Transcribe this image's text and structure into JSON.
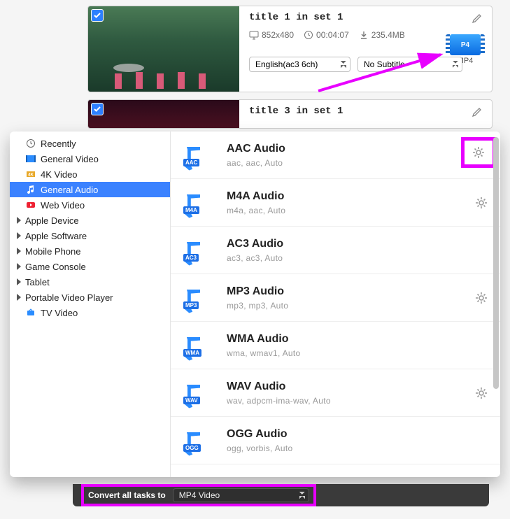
{
  "tasks": [
    {
      "title": "title 1 in set 1",
      "resolution": "852x480",
      "duration": "00:04:07",
      "size": "235.4MB",
      "format_short": "P4",
      "format_label": "MP4",
      "audio_track": "English(ac3 6ch)",
      "subtitle": "No Subtitle"
    },
    {
      "title": "title 3 in set 1"
    }
  ],
  "sidebar": {
    "items": [
      {
        "label": "Recently",
        "icon": "clock"
      },
      {
        "label": "General Video",
        "icon": "film"
      },
      {
        "label": "4K Video",
        "icon": "4k"
      },
      {
        "label": "General Audio",
        "icon": "note",
        "selected": true
      },
      {
        "label": "Web Video",
        "icon": "youtube"
      },
      {
        "label": "Apple Device",
        "expandable": true
      },
      {
        "label": "Apple Software",
        "expandable": true
      },
      {
        "label": "Mobile Phone",
        "expandable": true
      },
      {
        "label": "Game Console",
        "expandable": true
      },
      {
        "label": "Tablet",
        "expandable": true
      },
      {
        "label": "Portable Video Player",
        "expandable": true
      },
      {
        "label": "TV Video",
        "icon": "tv"
      }
    ]
  },
  "formats": [
    {
      "tag": "AAC",
      "title": "AAC Audio",
      "sub": "aac,    aac,    Auto"
    },
    {
      "tag": "M4A",
      "title": "M4A Audio",
      "sub": "m4a,    aac,    Auto"
    },
    {
      "tag": "AC3",
      "title": "AC3 Audio",
      "sub": "ac3,    ac3,    Auto"
    },
    {
      "tag": "MP3",
      "title": "MP3 Audio",
      "sub": "mp3,    mp3,    Auto"
    },
    {
      "tag": "WMA",
      "title": "WMA Audio",
      "sub": "wma,    wmav1,    Auto"
    },
    {
      "tag": "WAV",
      "title": "WAV Audio",
      "sub": "wav,    adpcm-ima-wav,    Auto"
    },
    {
      "tag": "OGG",
      "title": "OGG Audio",
      "sub": "ogg,    vorbis,    Auto"
    }
  ],
  "bottom": {
    "label": "Convert all tasks to",
    "selected": "MP4 Video"
  },
  "annotations": {
    "highlight_color": "#e800ff"
  }
}
